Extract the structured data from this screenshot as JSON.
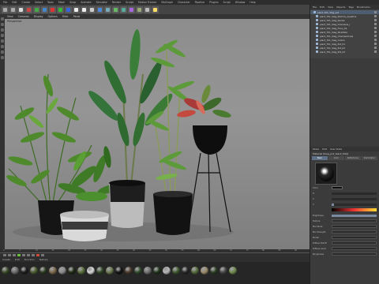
{
  "menubar": {
    "items": [
      "File",
      "Edit",
      "Create",
      "Select",
      "Tools",
      "Mesh",
      "Snap",
      "Animate",
      "Simulate",
      "Render",
      "Sculpt",
      "Motion Tracker",
      "MoGraph",
      "Character",
      "Pipeline",
      "Plugins",
      "Script",
      "Window",
      "Help"
    ]
  },
  "viewport": {
    "tabs": [
      "View",
      "Cameras",
      "Display",
      "Options",
      "Filter",
      "Panel"
    ],
    "name": "Perspective"
  },
  "timeline": {
    "ticks": [
      "0",
      "5",
      "10",
      "15",
      "20",
      "25",
      "30",
      "35",
      "40",
      "45",
      "50",
      "55",
      "60",
      "65",
      "70",
      "75",
      "80",
      "85",
      "90"
    ]
  },
  "material_manager": {
    "menu": [
      "Create",
      "Edit",
      "Function",
      "Texture"
    ],
    "materials": [
      {
        "color": "#3b4a2a"
      },
      {
        "color": "#6b6b6b"
      },
      {
        "color": "#1b1b1b"
      },
      {
        "color": "#4b5e2f"
      },
      {
        "color": "#2a3a1f"
      },
      {
        "color": "#7d6a4b"
      },
      {
        "color": "#8a8a8a"
      },
      {
        "color": "#1e2b15"
      },
      {
        "color": "#5a6e3a"
      },
      {
        "color": "#d8d8d8"
      },
      {
        "color": "#304525"
      },
      {
        "color": "#6a7a4e"
      },
      {
        "color": "#121212"
      },
      {
        "color": "#4a3a2a"
      },
      {
        "color": "#2f4a2a"
      },
      {
        "color": "#707070"
      },
      {
        "color": "#1f3318"
      },
      {
        "color": "#b8b8b8"
      },
      {
        "color": "#3e5a2e"
      },
      {
        "color": "#262626"
      },
      {
        "color": "#566b3c"
      },
      {
        "color": "#9c8a6a"
      },
      {
        "color": "#2b3f22"
      },
      {
        "color": "#474747"
      },
      {
        "color": "#6e8a4a"
      }
    ]
  },
  "object_manager": {
    "menu": [
      "File",
      "Edit",
      "View",
      "Objects",
      "Tags",
      "Bookmarks"
    ],
    "objects": [
      "plant_T01_Slag_set",
      "plant_T01_Slag_Pachira_aquatica",
      "plant_T01_Slag_Kentia",
      "plant_T01_Slag_Dracaena_r",
      "plant_T01_Slag_Ficus_01",
      "plant_T01_Slag_Strelitzia",
      "plant_T01_Slag_Chamaedorea",
      "plant_T01_Slag_Croton",
      "plant_T01_Slag_Pot_01",
      "plant_T01_Slag_Pot_02",
      "plant_T01_Slag_Pot_03"
    ]
  },
  "attribute_manager": {
    "menu": [
      "Mode",
      "Edit",
      "User Data"
    ],
    "title": "Material [Slag_pot_black_Mat]",
    "tabs": [
      "Basic",
      "Color",
      "Reflectance",
      "Illumination"
    ],
    "fields": [
      {
        "label": "Color",
        "kind": "swatch"
      },
      {
        "label": "H",
        "kind": "slider",
        "fill": 0.0
      },
      {
        "label": "S",
        "kind": "slider",
        "fill": 0.0
      },
      {
        "label": "V",
        "kind": "slider",
        "fill": 0.05
      },
      {
        "label": "",
        "kind": "grad"
      },
      {
        "label": "Brightness",
        "kind": "slider",
        "fill": 1.0
      }
    ],
    "sections": [
      "Texture",
      "Mix Mode",
      "Mix Strength",
      "Model",
      "Diffuse Falloff",
      "Diffuse Level",
      "Roughness"
    ]
  },
  "colors": {
    "accent_selection": "#4f5d70",
    "play_green": "#6cbf3a",
    "record_red": "#d24a3a"
  }
}
